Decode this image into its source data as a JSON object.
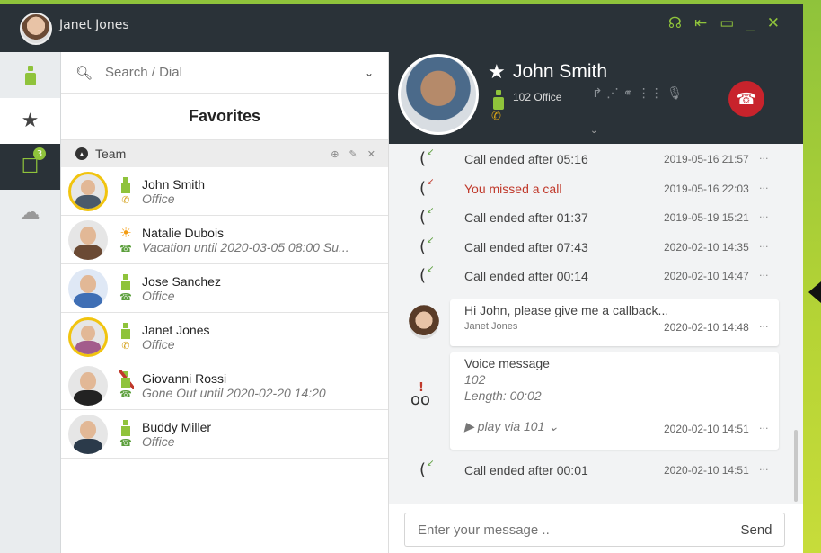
{
  "window": {
    "user_name": "Janet Jones"
  },
  "titlebar_icons": [
    "headset-icon",
    "pin-left-icon",
    "restore-icon",
    "minimize-icon",
    "close-icon"
  ],
  "titlebar_glyphs": {
    "headset": "☊",
    "pin": "⇤",
    "restore": "▭",
    "minimize": "_",
    "close": "✕"
  },
  "colors": {
    "accent": "#8fc33b",
    "dark": "#2a3238",
    "missed": "#c0392b",
    "hangup": "#c8232c",
    "busy": "#d4a017"
  },
  "sidebar": {
    "favorites_glyph": "★",
    "chat_glyph": "☐",
    "chat_badge": "3",
    "groups_glyph": "☁"
  },
  "search": {
    "placeholder": "Search / Dial",
    "dropdown_glyph": "⌄"
  },
  "favorites": {
    "title": "Favorites",
    "group": {
      "name": "Team",
      "caret_glyph": "▲",
      "icons_glyphs": "⊕ ✎ ✕"
    },
    "contacts": [
      {
        "name": "John Smith",
        "note": "Office",
        "status": "available",
        "phone": "on-call",
        "ring": true
      },
      {
        "name": "Natalie Dubois",
        "note": "Vacation until 2020-03-05 08:00 Su...",
        "status": "vacation",
        "phone": "idle",
        "ring": false
      },
      {
        "name": "Jose Sanchez",
        "note": "Office",
        "status": "available",
        "phone": "idle",
        "ring": false
      },
      {
        "name": "Janet Jones",
        "note": "Office",
        "status": "available",
        "phone": "on-call",
        "ring": true
      },
      {
        "name": "Giovanni Rossi",
        "note": "Gone Out until 2020-02-20 14:20",
        "status": "gone-out",
        "phone": "idle",
        "ring": false
      },
      {
        "name": "Buddy Miller",
        "note": "Office",
        "status": "available",
        "phone": "idle",
        "ring": false
      }
    ]
  },
  "call": {
    "name": "John Smith",
    "star": "★",
    "sub": "102 Office",
    "action_glyphs": "↱  ⋰  ⚭  ⋮⋮  🎙",
    "hangup_glyph": "☎",
    "expand_glyph": "⌄"
  },
  "messages": [
    {
      "type": "call",
      "text": "Call ended after 05:16",
      "time": "2019-05-16 21:57"
    },
    {
      "type": "missed",
      "text": "You missed a call",
      "time": "2019-05-16 22:03"
    },
    {
      "type": "call",
      "text": "Call ended after 01:37",
      "time": "2019-05-19 15:21"
    },
    {
      "type": "call",
      "text": "Call ended after 07:43",
      "time": "2020-02-10 14:35"
    },
    {
      "type": "call",
      "text": "Call ended after 00:14",
      "time": "2020-02-10 14:47"
    },
    {
      "type": "chat",
      "text": "Hi John, please give me a callback...",
      "sender": "Janet Jones",
      "time": "2020-02-10 14:48"
    },
    {
      "type": "voicemail",
      "title": "Voice message",
      "ext": "102",
      "length": "Length: 00:02",
      "play": "▶ play via 101 ⌄",
      "time": "2020-02-10 14:51"
    },
    {
      "type": "call",
      "text": "Call ended after 00:01",
      "time": "2020-02-10 14:51"
    }
  ],
  "more_glyph": "···",
  "composer": {
    "placeholder": "Enter your message ..",
    "send_label": "Send"
  }
}
